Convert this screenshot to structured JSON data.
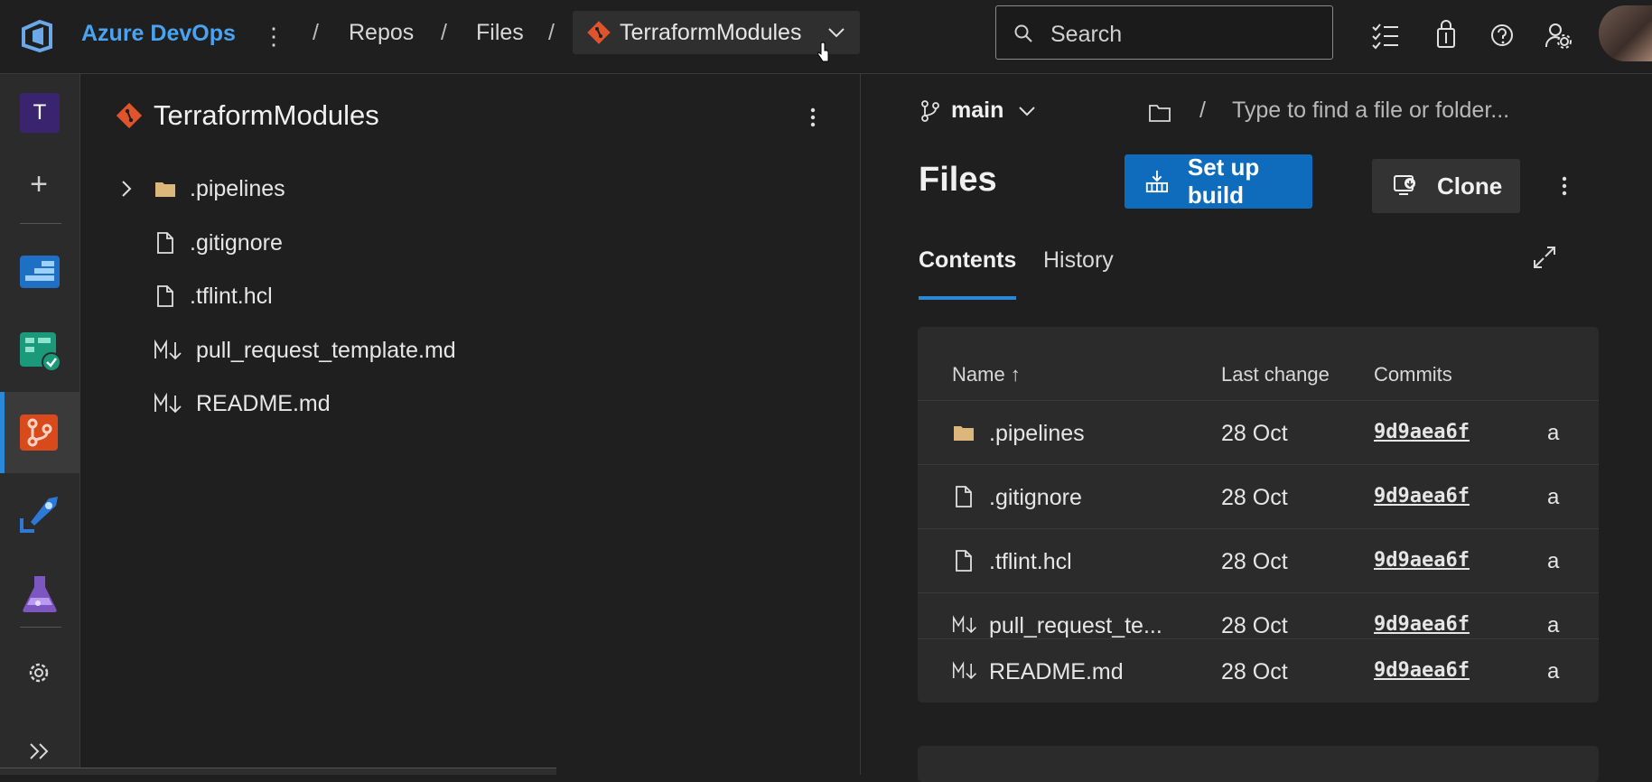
{
  "topbar": {
    "brand": "Azure DevOps",
    "breadcrumbs": [
      "Repos",
      "Files"
    ],
    "separator": "/",
    "repo": "TerraformModules",
    "search_placeholder": "Search"
  },
  "leftnav": {
    "project_initial": "T"
  },
  "tree": {
    "title": "TerraformModules",
    "items": [
      {
        "name": ".pipelines",
        "type": "folder",
        "icon": "folder-icon"
      },
      {
        "name": ".gitignore",
        "type": "file",
        "icon": "file-icon"
      },
      {
        "name": ".tflint.hcl",
        "type": "file",
        "icon": "file-icon"
      },
      {
        "name": "pull_request_template.md",
        "type": "markdown",
        "icon": "markdown-icon"
      },
      {
        "name": "README.md",
        "type": "markdown",
        "icon": "markdown-icon"
      }
    ]
  },
  "main": {
    "branch": "main",
    "path_placeholder": "Type to find a file or folder...",
    "path_separator": "/",
    "title": "Files",
    "setup_build_label": "Set up build",
    "clone_label": "Clone",
    "tabs": [
      "Contents",
      "History"
    ],
    "columns": [
      "Name ↑",
      "Last change",
      "Commits"
    ],
    "rows": [
      {
        "name": ".pipelines",
        "icon": "folder-icon",
        "date": "28 Oct",
        "commit": "9d9aea6f",
        "author": "a"
      },
      {
        "name": ".gitignore",
        "icon": "file-icon",
        "date": "28 Oct",
        "commit": "9d9aea6f",
        "author": "a"
      },
      {
        "name": ".tflint.hcl",
        "icon": "file-icon",
        "date": "28 Oct",
        "commit": "9d9aea6f",
        "author": "a"
      },
      {
        "name": "pull_request_te...",
        "icon": "markdown-icon",
        "date": "28 Oct",
        "commit": "9d9aea6f",
        "author": "a"
      },
      {
        "name": "README.md",
        "icon": "markdown-icon",
        "date": "28 Oct",
        "commit": "9d9aea6f",
        "author": "a"
      }
    ]
  },
  "colors": {
    "accent": "#0f6cbd",
    "brand": "#4aa3f0",
    "repo_icon": "#e0542c",
    "folder": "#dcb67a"
  }
}
